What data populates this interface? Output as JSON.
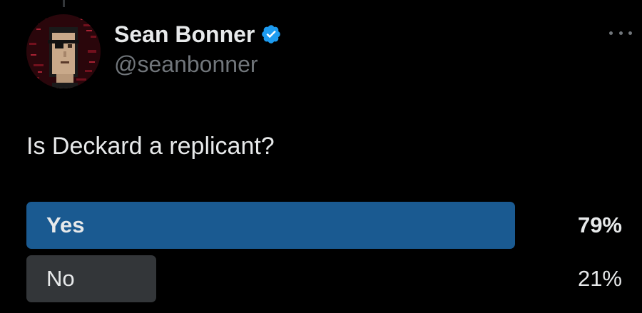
{
  "author": {
    "display_name": "Sean Bonner",
    "handle": "@seanbonner",
    "verified": true,
    "avatar_icon": "cryptopunk-avatar"
  },
  "menu": {
    "icon": "more-options-icon"
  },
  "tweet": {
    "text": "Is Deckard a replicant?"
  },
  "poll": {
    "options": [
      {
        "label": "Yes",
        "percent_text": "79%",
        "fraction": 0.82,
        "color": "#1a5a91",
        "winner": true
      },
      {
        "label": "No",
        "percent_text": "21%",
        "fraction": 0.218,
        "color": "#333639",
        "winner": false
      }
    ]
  },
  "colors": {
    "background": "#000000",
    "text_primary": "#e7e9ea",
    "text_secondary": "#71767b",
    "verified_blue": "#1d9bf0"
  }
}
